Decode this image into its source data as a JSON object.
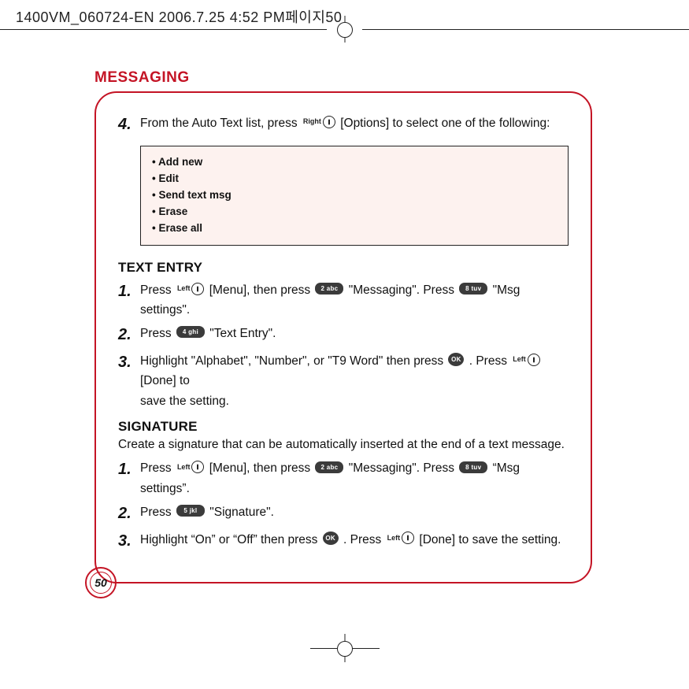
{
  "header": "1400VM_060724-EN  2006.7.25 4:52 PM페이지50",
  "title": "MESSAGING",
  "page_number": "50",
  "softkeys": {
    "left": "Left",
    "right": "Right",
    "ok": "OK"
  },
  "keys": {
    "k2": "2 abc",
    "k4": "4 ghi",
    "k5": "5 jkl",
    "k8": "8 tuv"
  },
  "intro": {
    "num": "4.",
    "pre": "From the Auto Text list, press ",
    "post": " [Options] to select one of the following:"
  },
  "options": [
    "Add new",
    "Edit",
    "Send text msg",
    "Erase",
    "Erase all"
  ],
  "text_entry": {
    "heading": "TEXT ENTRY",
    "s1": {
      "num": "1.",
      "a": "Press ",
      "b": " [Menu], then press ",
      "c": " \"Messaging\".  Press ",
      "d": " \"Msg settings\"."
    },
    "s2": {
      "num": "2.",
      "a": "Press ",
      "b": " \"Text Entry\"."
    },
    "s3": {
      "num": "3.",
      "a": "Highlight \"Alphabet\", \"Number\", or \"T9 Word\" then press ",
      "b": " .  Press ",
      "c": " [Done] to",
      "d": "save the setting."
    }
  },
  "signature": {
    "heading": "SIGNATURE",
    "desc": "Create a signature that can be automatically inserted at the end of a text message.",
    "s1": {
      "num": "1.",
      "a": "Press ",
      "b": " [Menu], then press ",
      "c": " \"Messaging\".  Press ",
      "d": " “Msg settings”."
    },
    "s2": {
      "num": "2.",
      "a": "Press ",
      "b": " \"Signature\"."
    },
    "s3": {
      "num": "3.",
      "a": "Highlight “On” or “Off” then press ",
      "b": " .  Press ",
      "c": " [Done] to save the setting."
    }
  }
}
